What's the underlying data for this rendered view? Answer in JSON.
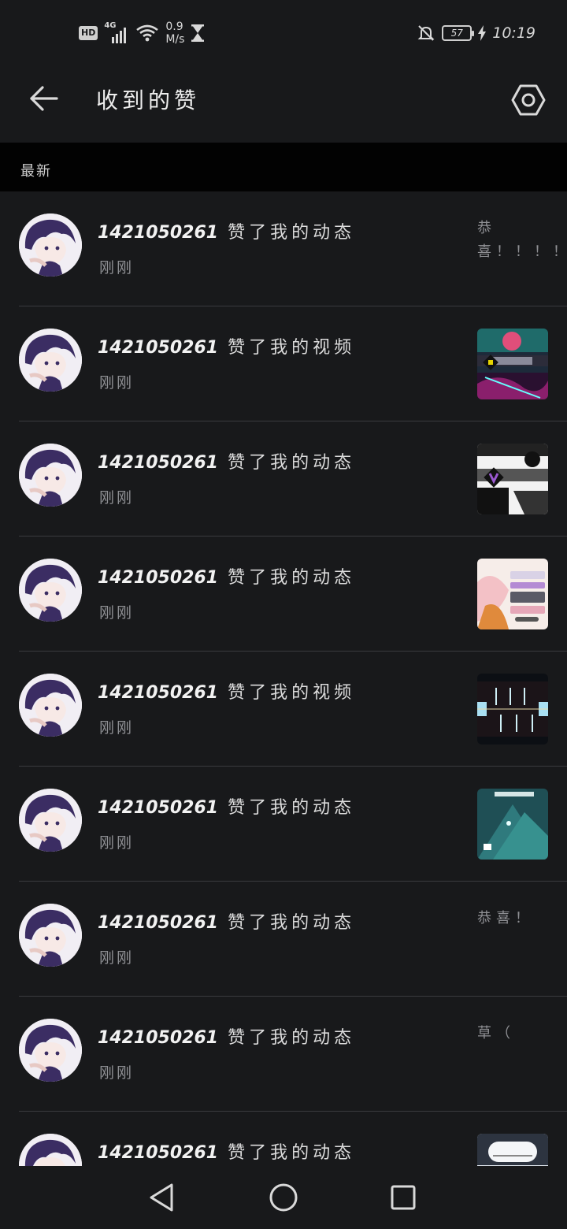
{
  "status_bar": {
    "hd": "HD",
    "network": "4G",
    "speed_value": "0.9",
    "speed_unit": "M/s",
    "battery": "57",
    "time": "10:19"
  },
  "header": {
    "title": "收到的赞",
    "back_icon": "back-arrow-icon",
    "settings_icon": "settings-hexagon-icon"
  },
  "section": {
    "label": "最新"
  },
  "notifications": [
    {
      "user": "1421050261",
      "action": "赞了我的动态",
      "time": "刚刚",
      "preview_text": "恭喜！！！！…"
    },
    {
      "user": "1421050261",
      "action": "赞了我的视频",
      "time": "刚刚",
      "preview_thumb": "game-screenshot-colorful"
    },
    {
      "user": "1421050261",
      "action": "赞了我的动态",
      "time": "刚刚",
      "preview_thumb": "game-screenshot-monochrome"
    },
    {
      "user": "1421050261",
      "action": "赞了我的动态",
      "time": "刚刚",
      "preview_thumb": "game-result-screen-pink"
    },
    {
      "user": "1421050261",
      "action": "赞了我的视频",
      "time": "刚刚",
      "preview_thumb": "rhythm-game-dark"
    },
    {
      "user": "1421050261",
      "action": "赞了我的动态",
      "time": "刚刚",
      "preview_thumb": "game-screenshot-teal"
    },
    {
      "user": "1421050261",
      "action": "赞了我的动态",
      "time": "刚刚",
      "preview_text": "恭喜！"
    },
    {
      "user": "1421050261",
      "action": "赞了我的动态",
      "time": "刚刚",
      "preview_text": "草（"
    },
    {
      "user": "1421050261",
      "action": "赞了我的动态",
      "time": "",
      "preview_thumb": "game-screenshot-light"
    }
  ],
  "nav_bar": {
    "back": "triangle-back-icon",
    "home": "circle-home-icon",
    "recents": "square-recents-icon"
  },
  "colors": {
    "background": "#18191b",
    "section_bg": "#020202",
    "primary_text": "#f2f2f2",
    "secondary_text": "#8f9094"
  }
}
